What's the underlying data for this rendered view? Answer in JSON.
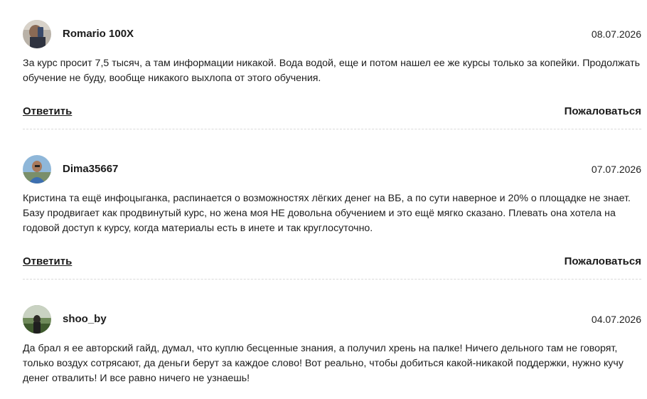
{
  "comments": [
    {
      "author": "Romario 100X",
      "date": "08.07.2026",
      "text": "За курс просит 7,5 тысяч, а там информации никакой. Вода водой, еще и потом нашел ее же курсы только за копейки. Продолжать обучение не буду, вообще никакого выхлопа от этого обучения.",
      "reply_label": "Ответить",
      "report_label": "Пожаловаться"
    },
    {
      "author": "Dima35667",
      "date": "07.07.2026",
      "text": "Кристина та ещё инфоцыганка, распинается о возможностях лёгких денег на ВБ, а по сути наверное и 20% о площадке не знает. Базу продвигает как продвинутый курс, но жена моя НЕ довольна обучением и это ещё мягко сказано. Плевать она хотела на годовой доступ к курсу, когда материалы есть в инете и так круглосуточно.",
      "reply_label": "Ответить",
      "report_label": "Пожаловаться"
    },
    {
      "author": "shoo_by",
      "date": "04.07.2026",
      "text": "Да брал я ее авторский гайд, думал, что куплю бесценные знания, а получил хрень на палке! Ничего дельного там не говорят, только воздух сотрясают, да деньги берут за каждое слово! Вот реально, чтобы добиться какой-никакой поддержки, нужно кучу денег отвалить! И все равно ничего не узнаешь!"
    }
  ]
}
